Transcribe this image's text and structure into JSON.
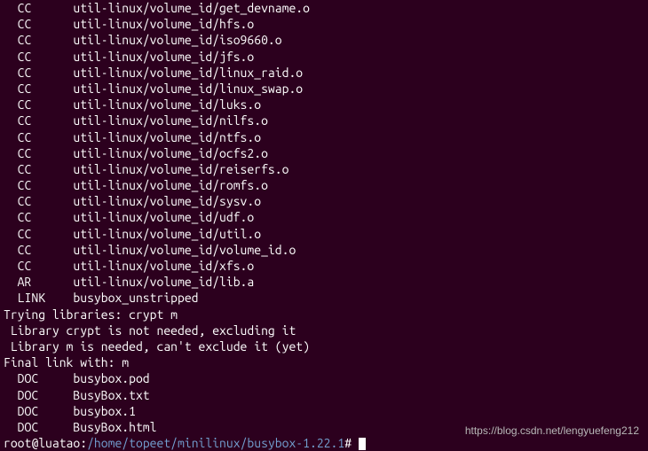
{
  "lines": [
    {
      "col1": "  CC",
      "col2": "util-linux/volume_id/get_devname.o"
    },
    {
      "col1": "  CC",
      "col2": "util-linux/volume_id/hfs.o"
    },
    {
      "col1": "  CC",
      "col2": "util-linux/volume_id/iso9660.o"
    },
    {
      "col1": "  CC",
      "col2": "util-linux/volume_id/jfs.o"
    },
    {
      "col1": "  CC",
      "col2": "util-linux/volume_id/linux_raid.o"
    },
    {
      "col1": "  CC",
      "col2": "util-linux/volume_id/linux_swap.o"
    },
    {
      "col1": "  CC",
      "col2": "util-linux/volume_id/luks.o"
    },
    {
      "col1": "  CC",
      "col2": "util-linux/volume_id/nilfs.o"
    },
    {
      "col1": "  CC",
      "col2": "util-linux/volume_id/ntfs.o"
    },
    {
      "col1": "  CC",
      "col2": "util-linux/volume_id/ocfs2.o"
    },
    {
      "col1": "  CC",
      "col2": "util-linux/volume_id/reiserfs.o"
    },
    {
      "col1": "  CC",
      "col2": "util-linux/volume_id/romfs.o"
    },
    {
      "col1": "  CC",
      "col2": "util-linux/volume_id/sysv.o"
    },
    {
      "col1": "  CC",
      "col2": "util-linux/volume_id/udf.o"
    },
    {
      "col1": "  CC",
      "col2": "util-linux/volume_id/util.o"
    },
    {
      "col1": "  CC",
      "col2": "util-linux/volume_id/volume_id.o"
    },
    {
      "col1": "  CC",
      "col2": "util-linux/volume_id/xfs.o"
    },
    {
      "col1": "  AR",
      "col2": "util-linux/volume_id/lib.a"
    },
    {
      "col1": "  LINK",
      "col2": "busybox_unstripped"
    }
  ],
  "plain_lines": [
    "Trying libraries: crypt m",
    " Library crypt is not needed, excluding it",
    " Library m is needed, can't exclude it (yet)",
    "Final link with: m"
  ],
  "doc_lines": [
    {
      "col1": "  DOC",
      "col2": "busybox.pod"
    },
    {
      "col1": "  DOC",
      "col2": "BusyBox.txt"
    },
    {
      "col1": "  DOC",
      "col2": "busybox.1"
    },
    {
      "col1": "  DOC",
      "col2": "BusyBox.html"
    }
  ],
  "prompt": {
    "user_host": "root@luatao",
    "sep": ":",
    "path": "/home/topeet/minilinux/busybox-1.22.1",
    "symbol": "#"
  },
  "watermark": "https://blog.csdn.net/lengyuefeng212"
}
